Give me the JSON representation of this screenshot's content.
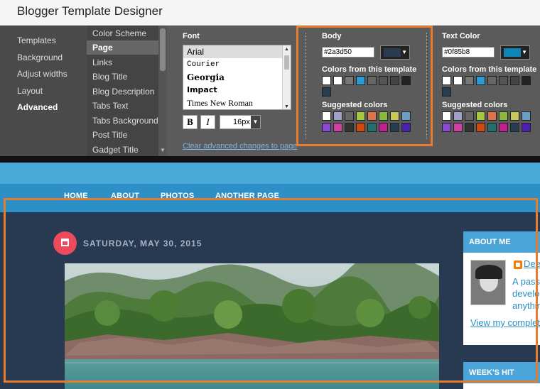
{
  "window": {
    "title": "Blogger Template Designer"
  },
  "left_nav": {
    "items": [
      "Templates",
      "Background",
      "Adjust widths",
      "Layout",
      "Advanced"
    ],
    "active": "Advanced"
  },
  "sub_nav": {
    "items": [
      "Color Scheme",
      "Page",
      "Links",
      "Blog Title",
      "Blog Description",
      "Tabs Text",
      "Tabs Background",
      "Post Title",
      "Gadget Title"
    ],
    "active": "Page"
  },
  "font": {
    "label": "Font",
    "options": [
      "Arial",
      "Courier",
      "Georgia",
      "Impact",
      "Times New Roman"
    ],
    "selected": "Arial",
    "bold_label": "B",
    "italic_label": "I",
    "size": "16px"
  },
  "clear_link": "Clear advanced changes to page",
  "body_color": {
    "label": "Body",
    "hex": "#2a3d50",
    "swatch": "#2a3d50",
    "template_label": "Colors from this template",
    "template_colors": [
      "#ffffff",
      "#ffffff",
      "#777777",
      "#2c9ad3",
      "#666666",
      "#555555",
      "#444444",
      "#222222",
      "#2a3d50"
    ],
    "suggested_label": "Suggested colors",
    "suggested_colors": [
      "#ffffff",
      "#a0a0c8",
      "#666666",
      "#a6c83c",
      "#e0724a",
      "#8ab83a",
      "#c8c85a",
      "#6aa0c8",
      "#8a4ad0",
      "#d040a0",
      "#333333",
      "#d04a10",
      "#207070",
      "#c02090",
      "#2a3d50",
      "#4a20b0"
    ]
  },
  "text_color": {
    "label": "Text Color",
    "hex": "#0f85b8",
    "swatch": "#0f85b8",
    "template_label": "Colors from this template",
    "template_colors": [
      "#ffffff",
      "#ffffff",
      "#777777",
      "#2c9ad3",
      "#666666",
      "#555555",
      "#444444",
      "#222222",
      "#2a3d50"
    ],
    "suggested_label": "Suggested colors",
    "suggested_colors": [
      "#ffffff",
      "#a0a0c8",
      "#666666",
      "#a6c83c",
      "#e0724a",
      "#8ab83a",
      "#c8c85a",
      "#6aa0c8",
      "#8a4ad0",
      "#d040a0",
      "#333333",
      "#d04a10",
      "#207070",
      "#c02090",
      "#2a3d50",
      "#4a20b0"
    ]
  },
  "blog": {
    "nav": [
      "HOME",
      "ABOUT",
      "PHOTOS",
      "ANOTHER PAGE"
    ],
    "date": "SATURDAY, MAY 30, 2015",
    "about_title": "ABOUT ME",
    "author_link": "Dee",
    "about_lines": [
      "A passi",
      "develo",
      "anythin"
    ],
    "profile_link": "View my complet",
    "weeks_hit_title": "WEEK'S HIT"
  },
  "colors": {
    "highlight": "#e87b2c",
    "accent_blue": "#2c8fc5",
    "date_icon": "#ec4a5d"
  }
}
